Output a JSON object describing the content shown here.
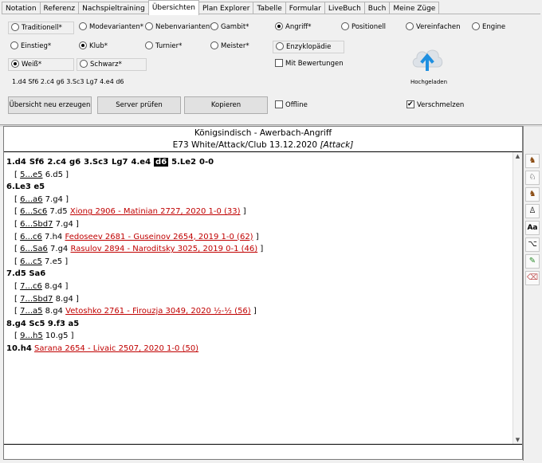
{
  "tabs": [
    "Notation",
    "Referenz",
    "Nachspieltraining",
    "Übersichten",
    "Plan Explorer",
    "Tabelle",
    "Formular",
    "LiveBuch",
    "Buch",
    "Meine Züge"
  ],
  "active_tab": "Übersichten",
  "options": {
    "traditionell": "Traditionell*",
    "modevarianten": "Modevarianten*",
    "nebenvarianten": "Nebenvarianten*",
    "gambit": "Gambit*",
    "angriff": "Angriff*",
    "positionell": "Positionell",
    "vereinfachen": "Vereinfachen",
    "engine": "Engine",
    "einstieg": "Einstieg*",
    "klub": "Klub*",
    "turnier": "Turnier*",
    "meister": "Meister*",
    "enzyklopaedie": "Enzyklopädie",
    "weiss": "Weiß*",
    "schwarz": "Schwarz*",
    "mit_bewertungen": "Mit Bewertungen",
    "offline": "Offline",
    "verschmelzen": "Verschmelzen"
  },
  "move_line": "1.d4 Sf6 2.c4 g6 3.Sc3 Lg7 4.e4 d6",
  "cloud_label": "Hochgeladen",
  "buttons": {
    "create": "Übersicht neu erzeugen",
    "check_server": "Server prüfen",
    "copy": "Kopieren"
  },
  "header": {
    "title": "Königsindisch - Awerbach-Angriff",
    "subtitle_plain": "E73 White/Attack/Club 13.12.2020 ",
    "subtitle_italic": "[Attack]"
  },
  "notation": {
    "l1_a": "1.d4",
    "l1_b": "Sf6",
    "l1_c": "2.c4",
    "l1_d": "g6",
    "l1_e": "3.Sc3",
    "l1_f": "Lg7",
    "l1_g": "4.e4",
    "l1_h": "d6",
    "l1_i": "5.Le2",
    "l1_j": "0-0",
    "v1_m": "5...e5",
    "v1_r": "6.d5 ]",
    "l2": "6.Le3  e5",
    "v2_m": "6...a6",
    "v2_r": "7.g4 ]",
    "v3_m": "6...Sc6",
    "v3_r": "7.d5",
    "v3_g": "Xiong 2906 - Matinian 2727, 2020 1-0 (33)",
    "v4_m": "6...Sbd7",
    "v4_r": "7.g4 ]",
    "v5_m": "6...c6",
    "v5_r": "7.h4",
    "v5_g": "Fedoseev 2681 - Guseinov 2654, 2019 1-0 (62)",
    "v6_m": "6...Sa6",
    "v6_r": "7.g4",
    "v6_g": "Rasulov 2894 - Naroditsky 3025, 2019 0-1 (46)",
    "v7_m": "6...c5",
    "v7_r": "7.e5 ]",
    "l3": "7.d5  Sa6",
    "v8_m": "7...c6",
    "v8_r": "8.g4 ]",
    "v9_m": "7...Sbd7",
    "v9_r": "8.g4 ]",
    "v10_m": "7...a5",
    "v10_r": "8.g4",
    "v10_g": "Vetoshko 2761 - Firouzja 3049, 2020 ½-½ (56)",
    "l4": "8.g4  Sc5  9.f3  a5",
    "v11_m": "9...h5",
    "v11_r": "10.g5 ]",
    "l5_m": "10.h4",
    "l5_g": "Sarana 2654 - Livaic 2507, 2020 1-0 (50)"
  },
  "accent": "#c00000"
}
